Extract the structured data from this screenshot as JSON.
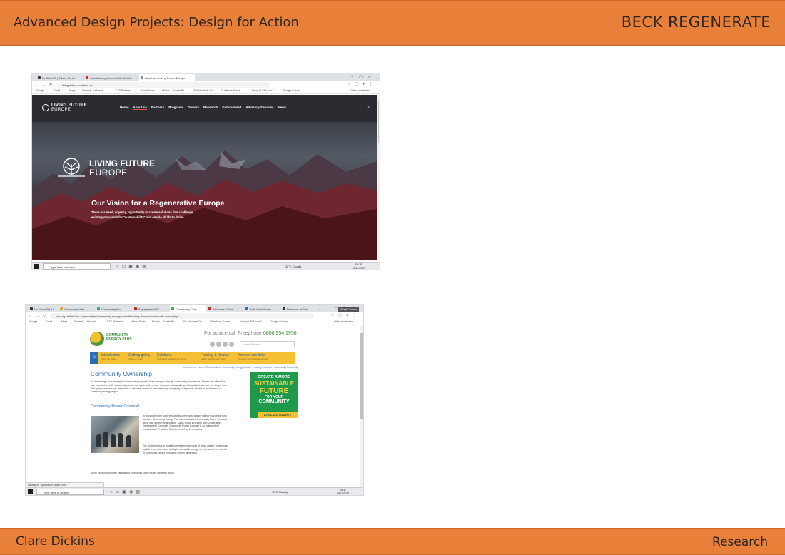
{
  "header": {
    "course_title": "Advanced Design Projects: Design for Action",
    "project_title": "BECK REGENERATE"
  },
  "footer": {
    "author": "Clare Dickins",
    "section": "Research"
  },
  "screenshot1": {
    "tabs": [
      "Mr Gavin B | Adobe Fonts",
      "munitaley synonyms with definiti...",
      "About us - Living Future Europe"
    ],
    "url": "living-future.eu/about-us/",
    "bookmarks": [
      "Google",
      "Gmail",
      "Maps",
      "Student – Universit...",
      "CTS Pinterest",
      "Adobe Fonts",
      "Photos – Google Ph...",
      "30+ Mountain Gu...",
      "£3 million+ Scenic...",
      "Home | UKIB.com C...",
      "Google Scholar",
      "Other bookmarks"
    ],
    "site": {
      "logo_line1": "LIVING FUTURE",
      "logo_line2": "EUROPE",
      "menu": [
        "Home",
        "About us",
        "Partners",
        "Programs",
        "Donors",
        "Research",
        "Get involved",
        "Advisory Services",
        "News"
      ],
      "hero_logo_line1": "LIVING FUTURE",
      "hero_logo_line2": "EUROPE",
      "hero_heading": "Our Vision for a Regenerative Europe",
      "hero_text": "There is a need, urgency, opportunity to create solutions that challenge existing standards for \"sustainability\" and enable all life to thrive"
    },
    "taskbar": {
      "search_placeholder": "Type here to search",
      "weather": "11°C  Cloudy",
      "time": "09:18",
      "date": "08/11/2022"
    }
  },
  "screenshot2": {
    "tabs": [
      "Mr Gavin B | Ad",
      "Community Ene...",
      "Community Eco...",
      "Engagement/BE...",
      "Community Own...",
      "Welcome Guide",
      "Bath West Home",
      "Provision of Ren..."
    ],
    "url": "cep.org.uk/help-for-communities/community-energy-toolkit/funding-finance/community-ownership/",
    "bookmarks": [
      "Google",
      "Gmail",
      "Maps",
      "Student – Universit...",
      "CTS Pinterest",
      "Adobe Fonts",
      "Photos – Google Ph...",
      "30+ Mountain Gu...",
      "£3 million+ Scenic...",
      "Home | UKIB.com C...",
      "Google Scholar",
      "Other bookmarks"
    ],
    "site": {
      "logo_line1": "COMMUNITY",
      "logo_line2": "ENERGY PLUS",
      "advice_prefix": "For advice call Freephone",
      "phone": "0800 954 1956",
      "search_placeholder": "Search this site",
      "cookies_button": "Reset Cookies",
      "menu": [
        {
          "label": "Introduction",
          "sub": "About the toolkit"
        },
        {
          "label": "Getting going",
          "sub": "Setting a project"
        },
        {
          "label": "Solutions",
          "sub": "Technical & regulatory for energy"
        },
        {
          "label": "Funding & finance",
          "sub": "Finding funds for your project"
        },
        {
          "label": "How we can help",
          "sub": "Our advice and additional services"
        }
      ],
      "breadcrumb": "You are here: Home / Communities / Community Energy Toolkit / Funding & finance / Community Ownership",
      "heading": "Community Ownership",
      "intro": "An increasingly popular way for community projects to raise money is through community share issues. Shares are offered for sale in a not-for-profit community owned enterprise and in return investors will usually get a financial return over the longer term. This type of scheme has the benefit of retaining control in the community and giving local people a stake in the future of a community energy project.",
      "subheading": "Community Power Cornwall",
      "para2": "In response to the barriers faced by community groups raising finance for wind turbines, Community Energy Plus has established Community Power Cornwall, along with another organisation, Kalai (Social Economy and Cooperative Development Cornwall). Community Power Cornwall is an independent Industrial and Provident Society, owned by its members.",
      "para3": "The Society exists to enable community ownership of these assets, to generate capital to be re-invested locally in renewable energy, and to nurture the spread of community owned renewable energy generation.",
      "para4": "Some examples of other established community share issues are listed below:",
      "ad_line1": "CREATE A MORE",
      "ad_line2": "SUSTAINABLE",
      "ad_line3": "FUTURE",
      "ad_line4": "FOR YOUR",
      "ad_line5": "COMMUNITY",
      "ad_call": "CALL US TODAY ›",
      "status_bar": "Waiting for syndication.twitter.com..."
    },
    "taskbar": {
      "search_placeholder": "Type here to search",
      "weather": "11°C  Cloudy",
      "time": "09:11",
      "date": "08/11/2022"
    }
  }
}
